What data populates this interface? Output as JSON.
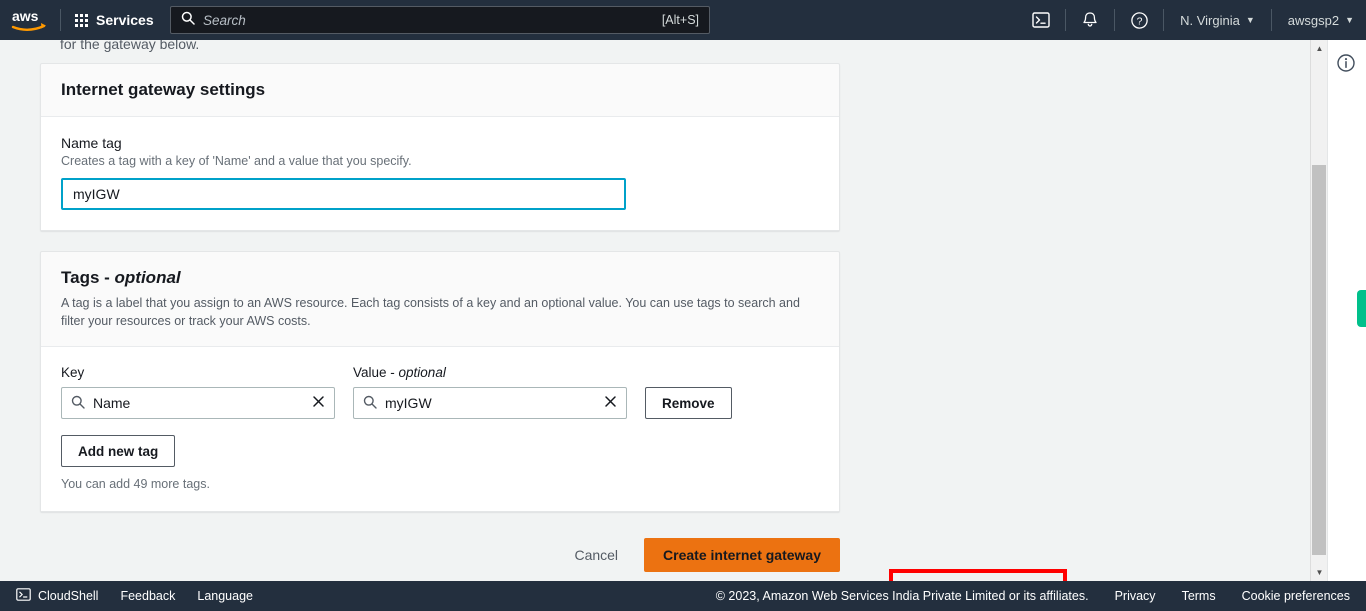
{
  "topnav": {
    "logo_alt": "aws",
    "services_label": "Services",
    "search": {
      "placeholder": "Search",
      "hint": "[Alt+S]"
    },
    "region_label": "N. Virginia",
    "account_label": "awsgsp2",
    "caret": "▼"
  },
  "content": {
    "clipped_text": "for the gateway below.",
    "gateway_card": {
      "title": "Internet gateway settings",
      "name_tag_label": "Name tag",
      "name_tag_hint": "Creates a tag with a key of 'Name' and a value that you specify.",
      "name_tag_value": "myIGW",
      "name_tag_placeholder": "Name tag"
    },
    "tags_card": {
      "title_main": "Tags - ",
      "title_optional": "optional",
      "description": "A tag is a label that you assign to an AWS resource. Each tag consists of a key and an optional value. You can use tags to search and filter your resources or track your AWS costs.",
      "key_label": "Key",
      "value_label_main": "Value - ",
      "value_label_optional": "optional",
      "key_value": "Name",
      "key_placeholder": "Key",
      "value_value": "myIGW",
      "value_placeholder": "Value",
      "remove_label": "Remove",
      "add_tag_label": "Add new tag",
      "tags_remaining_hint": "You can add 49 more tags."
    },
    "actions": {
      "cancel_label": "Cancel",
      "create_label": "Create internet gateway"
    }
  },
  "footer": {
    "cloudshell_label": "CloudShell",
    "feedback_label": "Feedback",
    "language_label": "Language",
    "copyright": "© 2023, Amazon Web Services India Private Limited or its affiliates.",
    "privacy_label": "Privacy",
    "terms_label": "Terms",
    "cookie_label": "Cookie preferences"
  },
  "colors": {
    "nav_background": "#232f3e",
    "page_background": "#f1f3f3",
    "primary_button": "#ec7211",
    "input_focus_border": "#00a1c9",
    "annotation_red": "#ff0000",
    "green_tab": "#00c08b"
  }
}
